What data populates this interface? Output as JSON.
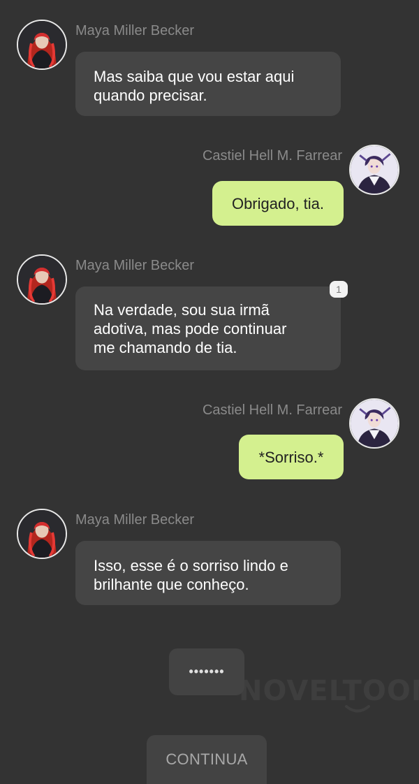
{
  "messages": [
    {
      "side": "left",
      "sender": "Maya Miller Becker",
      "lines": [
        "Mas saiba que vou estar aqui",
        "quando precisar."
      ]
    },
    {
      "side": "right",
      "sender": "Castiel Hell M. Farrear",
      "lines": [
        "Obrigado, tia."
      ]
    },
    {
      "side": "left",
      "sender": "Maya Miller Becker",
      "lines": [
        "Na verdade, sou sua irmã",
        "adotiva, mas pode continuar",
        "me chamando de tia."
      ],
      "badge": "1"
    },
    {
      "side": "right",
      "sender": "Castiel Hell M. Farrear",
      "lines": [
        "*Sorriso.*"
      ]
    },
    {
      "side": "left",
      "sender": "Maya Miller Becker",
      "lines": [
        "Isso, esse é o sorriso lindo e",
        "brilhante que conheço."
      ]
    }
  ],
  "typing_button": "•••••••",
  "watermark": "NOVELTOON",
  "continue_button": "CONTINUA",
  "colors": {
    "background": "#333333",
    "left_bubble": "#454545",
    "right_bubble": "#d4f08f",
    "name_text": "#8a8a8a"
  }
}
